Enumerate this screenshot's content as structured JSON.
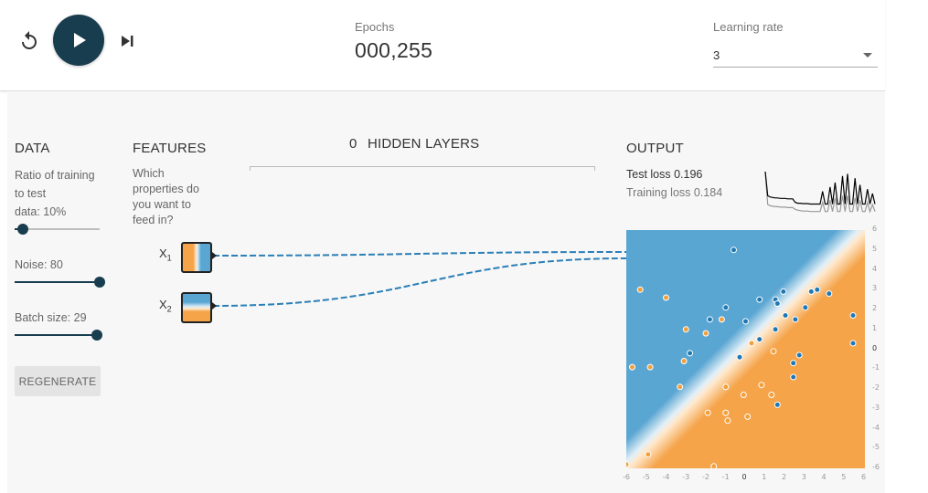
{
  "controls": {
    "reset_icon": "reset-icon",
    "play_icon": "play-icon",
    "step_icon": "step-icon"
  },
  "epochs": {
    "label": "Epochs",
    "value": "000,255"
  },
  "learning_rate": {
    "label": "Learning rate",
    "value": "3"
  },
  "data_panel": {
    "title": "DATA",
    "ratio_label_1": "Ratio of training",
    "ratio_label_2": "to test",
    "ratio_label_3": "data:  10%",
    "ratio_fraction": 0.1,
    "noise_label": "Noise:  80",
    "noise_fraction": 1.0,
    "batch_label": "Batch size:  29",
    "batch_fraction": 1.0,
    "regenerate": "REGENERATE"
  },
  "features_panel": {
    "title": "FEATURES",
    "desc_1": "Which",
    "desc_2": "properties do",
    "desc_3": "you want to",
    "desc_4": "feed in?",
    "x1_label": "X",
    "x1_sub": "1",
    "x2_label": "X",
    "x2_sub": "2"
  },
  "hidden_layers": {
    "count": "0",
    "label": "HIDDEN LAYERS"
  },
  "output_panel": {
    "title": "OUTPUT",
    "test_loss": "Test loss 0.196",
    "training_loss": "Training loss 0.184"
  },
  "colors": {
    "dark": "#183d4e",
    "orange": "#f5a44a",
    "blue": "#5aa6d2",
    "link": "#2a7fb8"
  },
  "plot": {
    "x_ticks": [
      "-6",
      "-5",
      "-4",
      "-3",
      "-2",
      "-1",
      "0",
      "1",
      "2",
      "3",
      "4",
      "5",
      "6"
    ],
    "y_ticks": [
      "6",
      "5",
      "4",
      "3",
      "2",
      "1",
      "0",
      "-1",
      "-2",
      "-3",
      "-4",
      "-5",
      "-6"
    ],
    "orange_points": [
      [
        -5.3,
        3.0
      ],
      [
        -4.0,
        2.6
      ],
      [
        -3.0,
        1.0
      ],
      [
        -2.0,
        0.8
      ],
      [
        -1.2,
        1.5
      ],
      [
        -3.1,
        -0.6
      ],
      [
        -5.7,
        -0.9
      ],
      [
        -4.8,
        -0.9
      ],
      [
        -3.3,
        -1.9
      ],
      [
        -1.0,
        -1.9
      ],
      [
        -0.1,
        -2.3
      ],
      [
        0.8,
        -1.8
      ],
      [
        1.3,
        -2.3
      ],
      [
        -1.9,
        -3.2
      ],
      [
        -1.0,
        -3.2
      ],
      [
        -0.9,
        -3.6
      ],
      [
        0.1,
        -3.4
      ],
      [
        0.3,
        0.3
      ],
      [
        1.4,
        -0.1
      ],
      [
        -6.0,
        -5.8
      ],
      [
        -4.9,
        -5.3
      ],
      [
        -1.6,
        -5.9
      ]
    ],
    "blue_points": [
      [
        -0.6,
        5.0
      ],
      [
        0.7,
        2.5
      ],
      [
        1.5,
        2.5
      ],
      [
        1.9,
        2.9
      ],
      [
        1.6,
        2.3
      ],
      [
        3.3,
        2.9
      ],
      [
        3.6,
        3.0
      ],
      [
        4.2,
        2.8
      ],
      [
        3.0,
        2.1
      ],
      [
        -1.0,
        2.1
      ],
      [
        -1.8,
        1.5
      ],
      [
        0.0,
        1.4
      ],
      [
        2.0,
        1.7
      ],
      [
        2.5,
        1.5
      ],
      [
        5.4,
        1.7
      ],
      [
        1.5,
        1.0
      ],
      [
        0.7,
        0.5
      ],
      [
        -2.8,
        -0.2
      ],
      [
        -0.3,
        -0.4
      ],
      [
        2.7,
        -0.3
      ],
      [
        2.4,
        -0.7
      ],
      [
        5.4,
        0.3
      ],
      [
        2.4,
        -1.4
      ],
      [
        1.6,
        -2.8
      ]
    ]
  },
  "loss_series": {
    "test": [
      1.0,
      0.45,
      0.42,
      0.41,
      0.4,
      0.4,
      0.39,
      0.39,
      0.39,
      0.38,
      0.38,
      0.38,
      0.3,
      0.28,
      0.28,
      0.27,
      0.27,
      0.27,
      0.26,
      0.26,
      0.26,
      0.26,
      0.26,
      0.55,
      0.26,
      0.26,
      0.65,
      0.26,
      0.75,
      0.26,
      0.26,
      0.9,
      0.26,
      0.95,
      0.26,
      0.26,
      0.85,
      0.26,
      0.7,
      0.26,
      0.26,
      0.6,
      0.26,
      0.5,
      0.26
    ],
    "train": [
      1.0,
      0.25,
      0.22,
      0.21,
      0.2,
      0.2,
      0.19,
      0.19,
      0.19,
      0.18,
      0.18,
      0.18,
      0.14,
      0.12,
      0.11,
      0.1,
      0.1,
      0.1,
      0.09,
      0.09,
      0.09,
      0.09,
      0.09,
      0.3,
      0.09,
      0.09,
      0.35,
      0.09,
      0.4,
      0.09,
      0.09,
      0.45,
      0.09,
      0.45,
      0.09,
      0.09,
      0.4,
      0.09,
      0.35,
      0.09,
      0.09,
      0.3,
      0.09,
      0.25,
      0.09
    ]
  }
}
